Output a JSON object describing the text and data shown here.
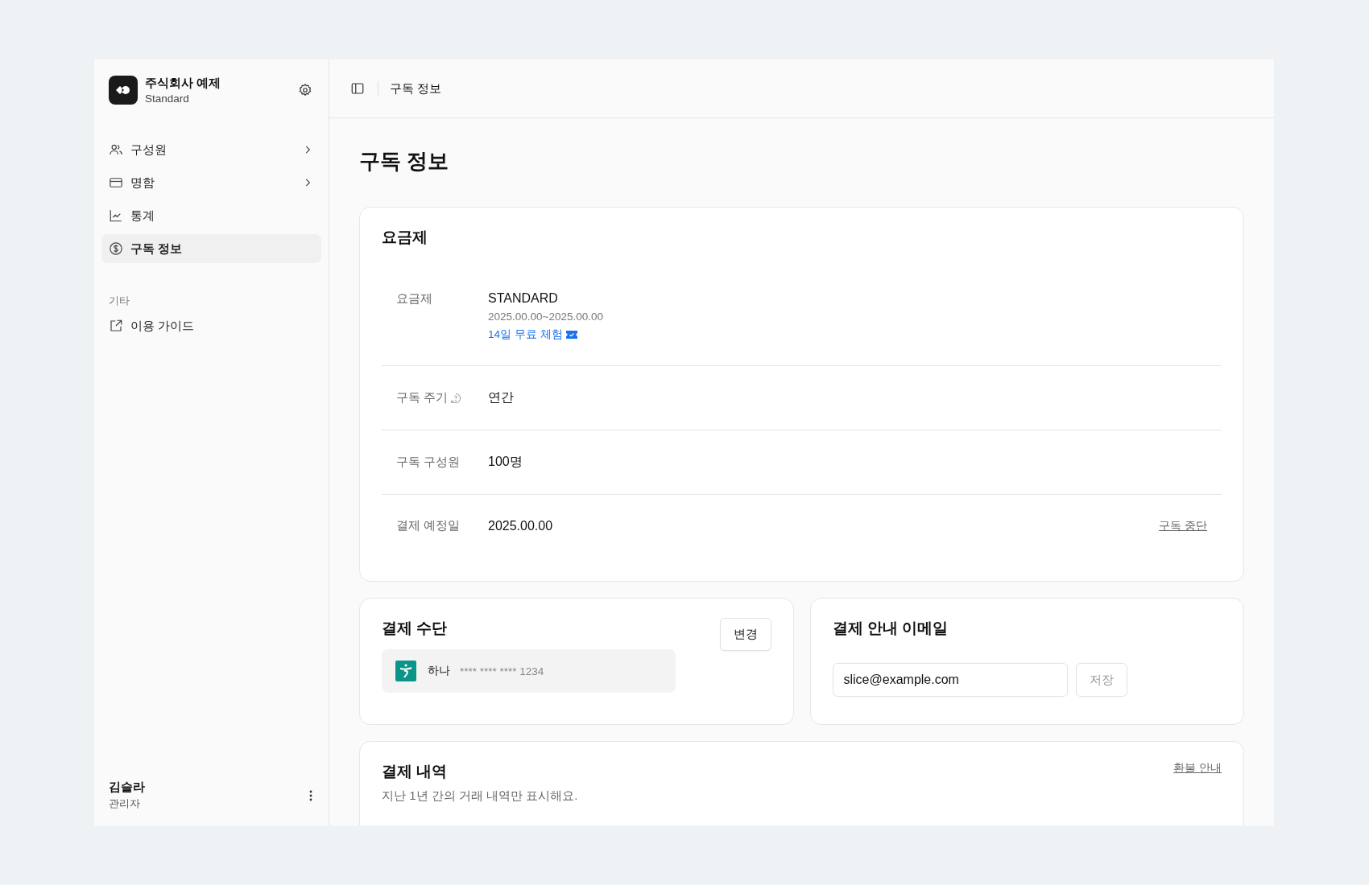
{
  "workspace": {
    "name": "주식회사 예제",
    "plan": "Standard"
  },
  "nav": [
    {
      "label": "구성원",
      "chevron": true,
      "selected": false
    },
    {
      "label": "명함",
      "chevron": true,
      "selected": false
    },
    {
      "label": "통계",
      "chevron": false,
      "selected": false
    },
    {
      "label": "구독 정보",
      "chevron": false,
      "selected": true
    }
  ],
  "other_section": {
    "title": "기타",
    "items": [
      {
        "label": "이용 가이드"
      }
    ]
  },
  "user": {
    "name": "김슬라",
    "role": "관리자"
  },
  "header": {
    "title": "구독 정보"
  },
  "page_title": "구독 정보",
  "plan_card": {
    "title": "요금제",
    "rows": [
      {
        "kind": "plan",
        "label": "요금제",
        "value": "STANDARD",
        "period": "2025.00.00~2025.00.00",
        "badge": "14일 무료 체험"
      },
      {
        "kind": "help",
        "label": "구독 주기",
        "value": "연간"
      },
      {
        "kind": "plain",
        "label": "구독 구성원",
        "value": "100명"
      },
      {
        "kind": "action",
        "label": "결제 예정일",
        "value": "2025.00.00",
        "action": "구독 중단"
      }
    ]
  },
  "payment_method": {
    "title": "결제 수단",
    "button": "변경",
    "bank": "하나",
    "number": "**** **** **** 1234"
  },
  "billing_email": {
    "title": "결제 안내 이메일",
    "value": "slice@example.com",
    "button": "저장",
    "button_disabled": true
  },
  "history": {
    "title": "결제 내역",
    "description": "지난 1년 간의 거래 내역만 표시해요.",
    "link": "환불 안내"
  }
}
